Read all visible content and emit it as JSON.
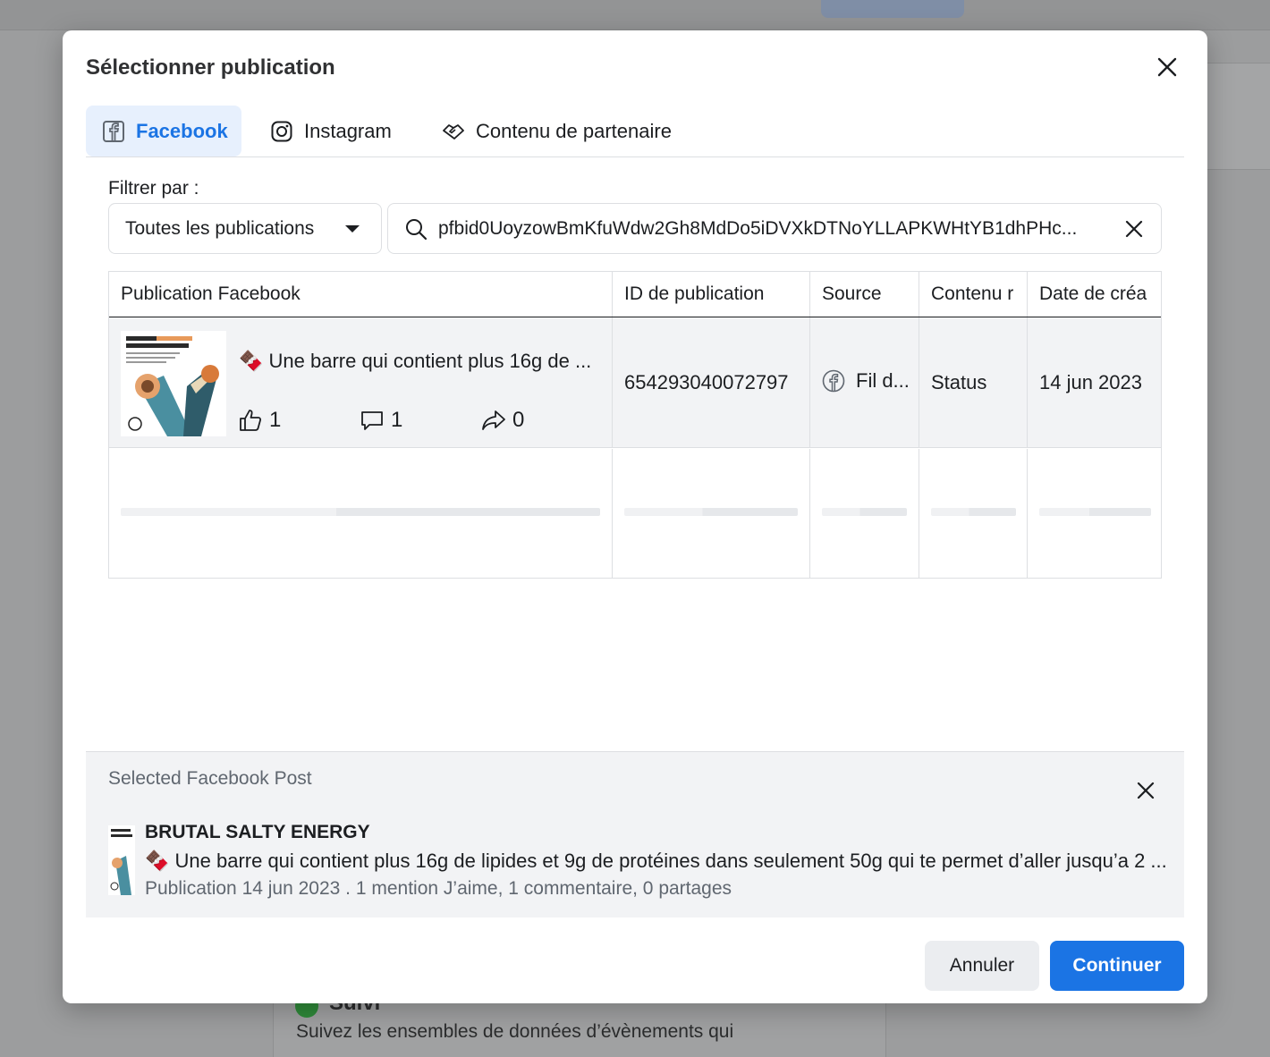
{
  "background": {
    "card_title": "Suivi",
    "card_text": "Suivez les ensembles de données d’évènements qui"
  },
  "modal": {
    "title": "Sélectionner publication",
    "tabs": [
      {
        "label": "Facebook",
        "icon": "facebook-icon",
        "active": true
      },
      {
        "label": "Instagram",
        "icon": "instagram-icon",
        "active": false
      },
      {
        "label": "Contenu de partenaire",
        "icon": "handshake-icon",
        "active": false
      }
    ],
    "filter": {
      "label": "Filtrer par :",
      "dropdown_value": "Toutes les publications",
      "search_value": "pfbid0UoyzowBmKfuWdw2Gh8MdDo5iDVXkDTNoYLLAPKWHtYB1dhPHc..."
    },
    "table": {
      "columns": [
        "Publication Facebook",
        "ID de publication",
        "Source",
        "Contenu r",
        "Date de créa"
      ],
      "rows": [
        {
          "text": "🍫 Une barre qui contient plus 16g de ...",
          "likes": "1",
          "comments": "1",
          "shares": "0",
          "id": "654293040072797",
          "source": "Fil d...",
          "content": "Status",
          "date": "14 jun 2023"
        }
      ]
    },
    "selected": {
      "label": "Selected Facebook Post",
      "page_name": "BRUTAL SALTY ENERGY",
      "text": "🍫 Une barre qui contient plus 16g de lipides et 9g de protéines dans seulement 50g qui te permet d’aller jusqu’a 2 ...",
      "meta": "Publication 14 jun 2023 . 1 mention J’aime, 1 commentaire, 0 partages"
    },
    "buttons": {
      "cancel": "Annuler",
      "continue": "Continuer"
    },
    "colors": {
      "accent": "#1b74e4",
      "active_tab_bg": "#e7f0fd",
      "row_highlight": "#f2f3f5"
    }
  }
}
